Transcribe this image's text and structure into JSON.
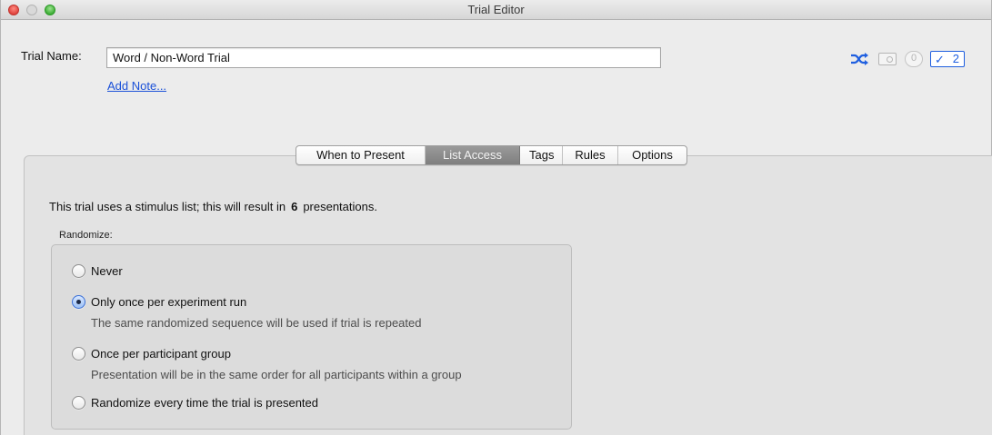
{
  "window": {
    "title": "Trial Editor"
  },
  "form": {
    "trial_name_label": "Trial Name:",
    "trial_name_value": "Word / Non-Word Trial",
    "add_note_link": "Add Note..."
  },
  "status_icons": {
    "shuffle_icon": "shuffle-icon",
    "card_icon": "card-icon",
    "zero_badge": "0",
    "checked_badge_count": "2",
    "accent_color": "#1f5fe0"
  },
  "tabs": [
    {
      "label": "When to Present",
      "active": false
    },
    {
      "label": "List Access",
      "active": true
    },
    {
      "label": "Tags",
      "active": false
    },
    {
      "label": "Rules",
      "active": false
    },
    {
      "label": "Options",
      "active": false
    }
  ],
  "list_access": {
    "summary_prefix": "This trial uses a stimulus list; this will result in",
    "presentation_count": "6",
    "summary_suffix": "presentations.",
    "randomize_label": "Randomize:",
    "options": [
      {
        "label": "Never",
        "selected": false
      },
      {
        "label": "Only once per experiment run",
        "selected": true,
        "description": "The same randomized sequence will be used if trial is repeated"
      },
      {
        "label": "Once per participant group",
        "selected": false,
        "description": "Presentation will be in the same order for all participants within a group"
      },
      {
        "label": "Randomize every time the trial is presented",
        "selected": false
      }
    ]
  }
}
